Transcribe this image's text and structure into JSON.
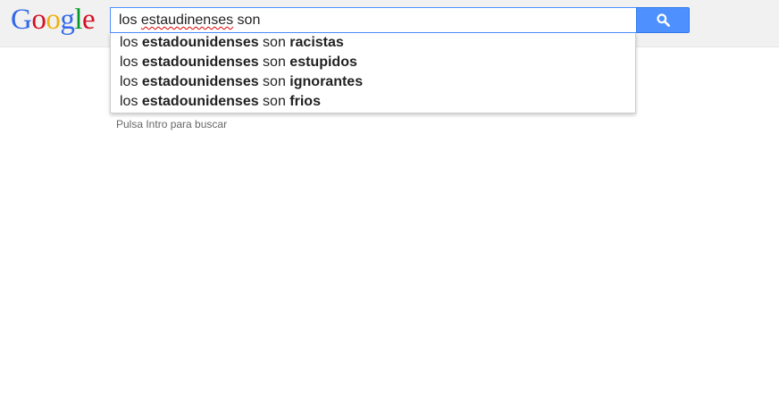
{
  "logo": {
    "letters": [
      {
        "char": "G",
        "color": "#3369e8"
      },
      {
        "char": "o",
        "color": "#d50f25"
      },
      {
        "char": "o",
        "color": "#eeb211"
      },
      {
        "char": "g",
        "color": "#3369e8"
      },
      {
        "char": "l",
        "color": "#009925"
      },
      {
        "char": "e",
        "color": "#d50f25"
      }
    ]
  },
  "search": {
    "query_prefix": "los ",
    "query_misspelled": "estaudinenses",
    "query_suffix": " son",
    "button_icon": "search-icon"
  },
  "suggestions": [
    {
      "base": "los ",
      "bold_mid": "estadounidenses",
      "mid": " son ",
      "bold_end": "racistas"
    },
    {
      "base": "los ",
      "bold_mid": "estadounidenses",
      "mid": " son ",
      "bold_end": "estupidos"
    },
    {
      "base": "los ",
      "bold_mid": "estadounidenses",
      "mid": " son ",
      "bold_end": "ignorantes"
    },
    {
      "base": "los ",
      "bold_mid": "estadounidenses",
      "mid": " son ",
      "bold_end": "frios"
    }
  ],
  "hint": "Pulsa Intro para buscar",
  "colors": {
    "button": "#4d90fe",
    "topbar": "#f1f1f1",
    "hint": "#666666"
  }
}
